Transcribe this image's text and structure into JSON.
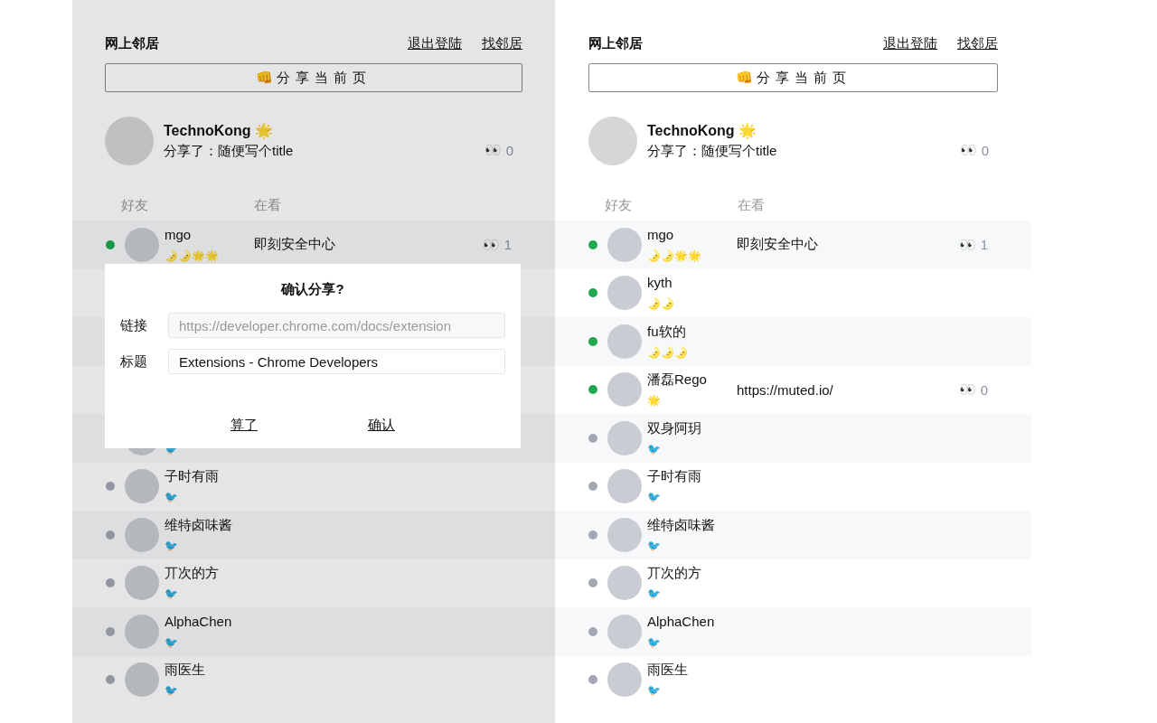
{
  "panels": [
    {
      "header": {
        "title": "网上邻居",
        "links": [
          "退出登陆",
          "找邻居"
        ]
      },
      "share_button": {
        "icon": "👊",
        "label": "分享当前页"
      },
      "me": {
        "name": "TechnoKong",
        "badge": "🌟",
        "shared": "分享了：随便写个title",
        "eyes": "👀",
        "views": "0"
      },
      "columns": [
        "好友",
        "在看"
      ],
      "friends": [
        {
          "name": "mgo",
          "badges": "🌛🌛🌟🌟",
          "online": true,
          "watching": "即刻安全中心",
          "eyes": "👀",
          "views": "1"
        }
      ],
      "friends_below_dialog": [
        {
          "badges": "🐦"
        },
        {
          "name": "子时有雨",
          "badges": "🐦",
          "online": false
        },
        {
          "name": "维特卤味酱",
          "badges": "🐦",
          "online": false
        },
        {
          "name": "丌次的方",
          "badges": "🐦",
          "online": false
        },
        {
          "name": "AlphaChen",
          "badges": "🐦",
          "online": false
        },
        {
          "name": "雨医生",
          "badges": "🐦",
          "online": false
        }
      ],
      "dialog": {
        "title": "确认分享?",
        "fields": [
          {
            "label": "链接",
            "value": "https://developer.chrome.com/docs/extension",
            "disabled": true
          },
          {
            "label": "标题",
            "value": "Extensions - Chrome Developers",
            "disabled": false
          }
        ],
        "buttons": [
          "算了",
          "确认"
        ]
      }
    },
    {
      "header": {
        "title": "网上邻居",
        "links": [
          "退出登陆",
          "找邻居"
        ]
      },
      "share_button": {
        "icon": "👊",
        "label": "分享当前页"
      },
      "me": {
        "name": "TechnoKong",
        "badge": "🌟",
        "shared": "分享了：随便写个title",
        "eyes": "👀",
        "views": "0"
      },
      "columns": [
        "好友",
        "在看"
      ],
      "friends": [
        {
          "name": "mgo",
          "badges": "🌛🌛🌟🌟",
          "online": true,
          "watching": "即刻安全中心",
          "eyes": "👀",
          "views": "1"
        },
        {
          "name": "kyth",
          "badges": "🌛🌛",
          "online": true
        },
        {
          "name": "fu软的",
          "badges": "🌛🌛🌛",
          "online": true
        },
        {
          "name": "潘磊Rego",
          "badges": "🌟",
          "online": true,
          "watching": "https://muted.io/",
          "eyes": "👀",
          "views": "0"
        },
        {
          "name": "双身阿玥",
          "badges": "🐦",
          "online": false
        },
        {
          "name": "子时有雨",
          "badges": "🐦",
          "online": false
        },
        {
          "name": "维特卤味酱",
          "badges": "🐦",
          "online": false
        },
        {
          "name": "丌次的方",
          "badges": "🐦",
          "online": false
        },
        {
          "name": "AlphaChen",
          "badges": "🐦",
          "online": false
        },
        {
          "name": "雨医生",
          "badges": "🐦",
          "online": false
        }
      ]
    }
  ]
}
